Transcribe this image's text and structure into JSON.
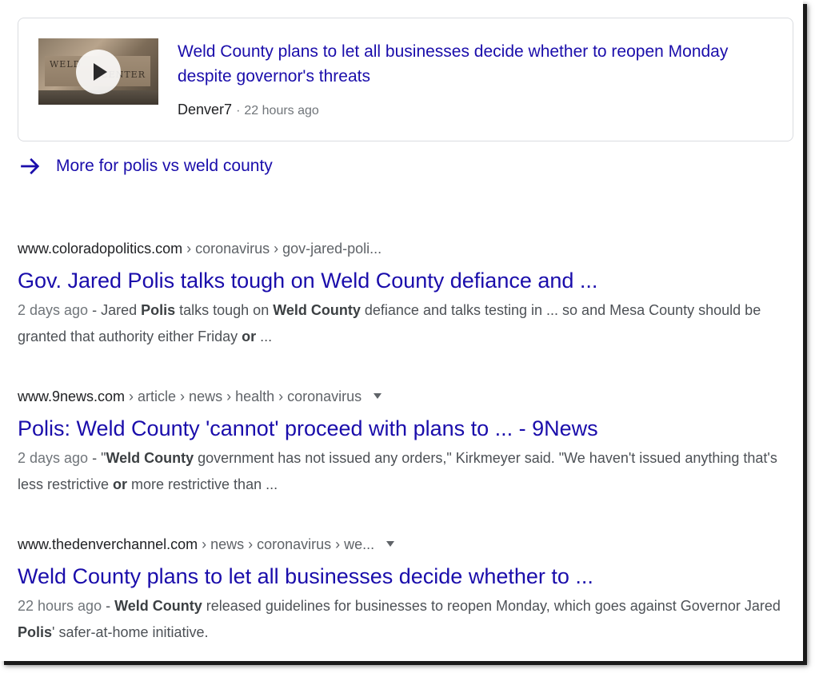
{
  "top_story": {
    "title": "Weld County plans to let all businesses decide whether to reopen Monday despite governor's threats",
    "source": "Denver7",
    "separator": "·",
    "time": "22 hours ago",
    "thumbnail_text_1": "WELD",
    "thumbnail_text_2": "CENTER"
  },
  "more_link": {
    "label": "More for polis vs weld county"
  },
  "results": [
    {
      "domain": "www.coloradopolitics.com",
      "path": " › coronavirus › gov-jared-poli...",
      "has_menu": false,
      "title": "Gov. Jared Polis talks tough on Weld County defiance and ...",
      "date": "2 days ago",
      "snippet": [
        {
          "t": "Jared "
        },
        {
          "b": "Polis"
        },
        {
          "t": " talks tough on "
        },
        {
          "b": "Weld County"
        },
        {
          "t": " defiance and talks testing in ... so and Mesa County should be granted that authority either Friday "
        },
        {
          "b": "or"
        },
        {
          "t": " ..."
        }
      ]
    },
    {
      "domain": "www.9news.com",
      "path": " › article › news › health › coronavirus",
      "has_menu": true,
      "title": "Polis: Weld County 'cannot' proceed with plans to ... - 9News",
      "date": "2 days ago",
      "snippet": [
        {
          "t": "\""
        },
        {
          "b": "Weld County"
        },
        {
          "t": " government has not issued any orders,\" Kirkmeyer said. \"We haven't issued anything that's less restrictive "
        },
        {
          "b": "or"
        },
        {
          "t": " more restrictive than ..."
        }
      ]
    },
    {
      "domain": "www.thedenverchannel.com",
      "path": " › news › coronavirus › we...",
      "has_menu": true,
      "title": "Weld County plans to let all businesses decide whether to ...",
      "date": "22 hours ago",
      "snippet": [
        {
          "b": "Weld County"
        },
        {
          "t": " released guidelines for businesses to reopen Monday, which goes against Governor Jared "
        },
        {
          "b": "Polis"
        },
        {
          "t": "' safer-at-home initiative."
        }
      ]
    }
  ],
  "colors": {
    "link": "#1a0dab",
    "text": "#202124",
    "muted": "#70757a",
    "border": "#dadce0"
  }
}
